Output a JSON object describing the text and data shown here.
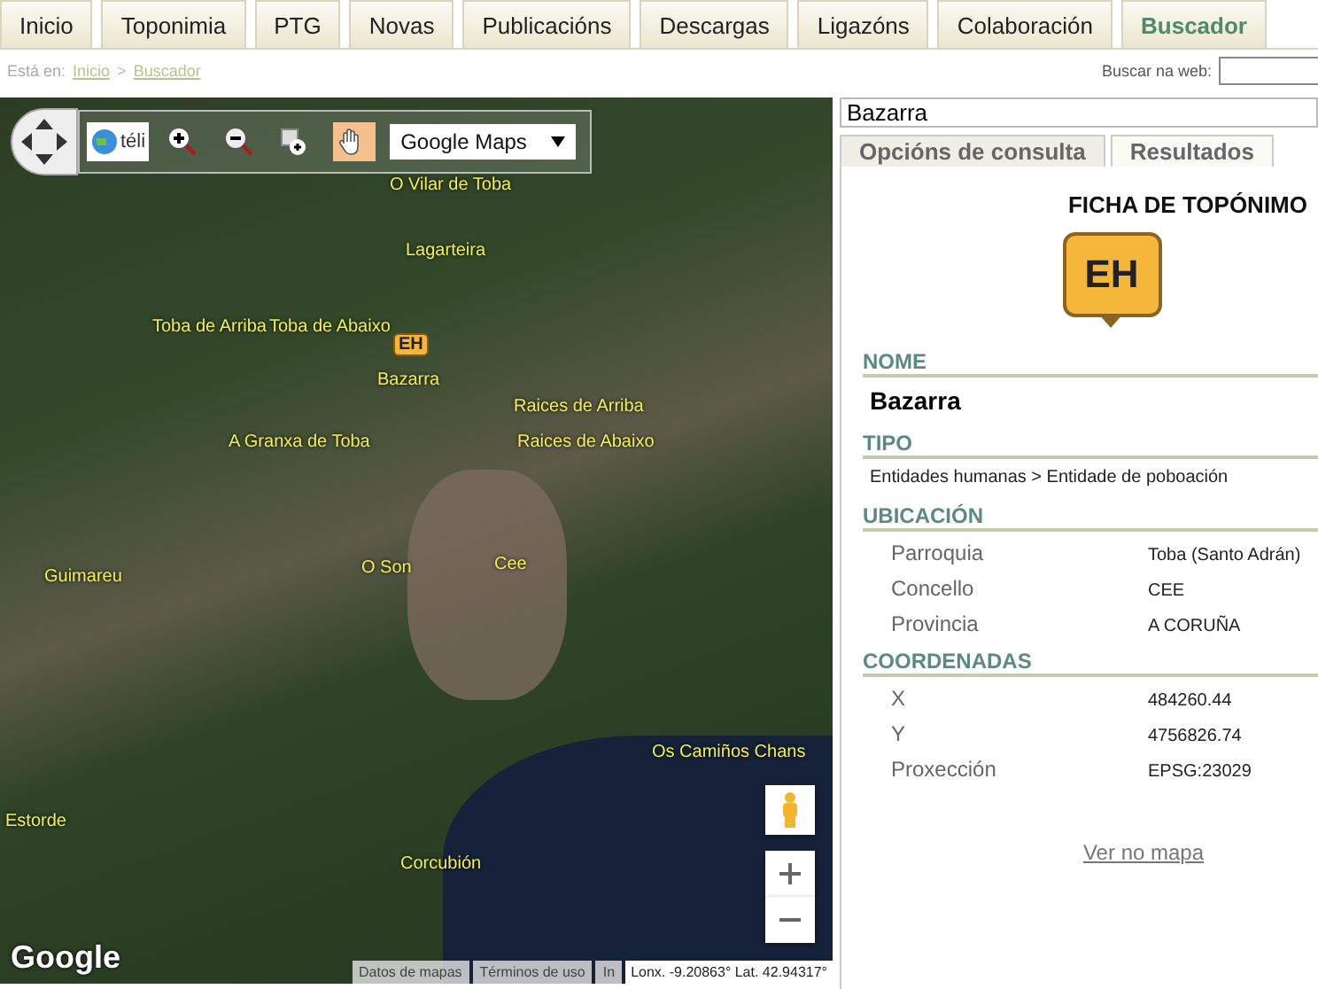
{
  "nav": {
    "tabs": [
      {
        "label": "Inicio",
        "selected": false
      },
      {
        "label": "Toponimia",
        "selected": false
      },
      {
        "label": "PTG",
        "selected": false
      },
      {
        "label": "Novas",
        "selected": false
      },
      {
        "label": "Publicacións",
        "selected": false
      },
      {
        "label": "Descargas",
        "selected": false
      },
      {
        "label": "Ligazóns",
        "selected": false
      },
      {
        "label": "Colaboración",
        "selected": false
      },
      {
        "label": "Buscador",
        "selected": true
      }
    ]
  },
  "breadcrumb": {
    "prefix": "Está en:",
    "items": [
      "Inicio",
      "Buscador"
    ],
    "separator": ">"
  },
  "web_search": {
    "label": "Buscar na web:"
  },
  "map": {
    "toolbar": {
      "tools": [
        {
          "kind": "globe",
          "label": "téli",
          "selected": false
        },
        {
          "kind": "zoom-in",
          "selected": false
        },
        {
          "kind": "zoom-out",
          "selected": false
        },
        {
          "kind": "zoom-box",
          "selected": false
        },
        {
          "kind": "pan",
          "selected": true
        }
      ],
      "base_layer": "Google Maps"
    },
    "marker": "EH",
    "labels": [
      "O Vilar de Toba",
      "Lagarteira",
      "Toba de Arriba",
      "Toba de Abaixo",
      "Bazarra",
      "Raices de Arriba",
      "A Granxa de Toba",
      "Raices de Abaixo",
      "Guimareu",
      "O Son",
      "Cee",
      "Os Camiños Chans",
      "Estorde",
      "Corcubión"
    ],
    "logo": "Google",
    "links": [
      "Datos de mapas",
      "Términos de uso",
      "In"
    ],
    "coordinates": "Lonx. -9.20863° Lat. 42.94317°"
  },
  "panel": {
    "search_value": "Bazarra",
    "tabs": [
      {
        "label": "Opcións de consulta",
        "selected": false
      },
      {
        "label": "Resultados",
        "selected": true
      }
    ],
    "title": "FICHA DE TOPÓNIMO",
    "badge": "EH",
    "sections": [
      {
        "heading": "NOME",
        "kind": "name",
        "value": "Bazarra"
      },
      {
        "heading": "TIPO",
        "kind": "text",
        "value": "Entidades humanas > Entidade de poboación"
      },
      {
        "heading": "UBICACIÓN",
        "kind": "fields",
        "fields": [
          {
            "label": "Parroquia",
            "value": "Toba (Santo Adrán)"
          },
          {
            "label": "Concello",
            "value": "CEE"
          },
          {
            "label": "Provincia",
            "value": "A CORUÑA"
          }
        ]
      },
      {
        "heading": "COORDENADAS",
        "kind": "fields",
        "fields": [
          {
            "label": "X",
            "value": "484260.44"
          },
          {
            "label": "Y",
            "value": "4756826.74"
          },
          {
            "label": "Proxección",
            "value": "EPSG:23029"
          }
        ]
      }
    ],
    "link": "Ver no mapa"
  }
}
